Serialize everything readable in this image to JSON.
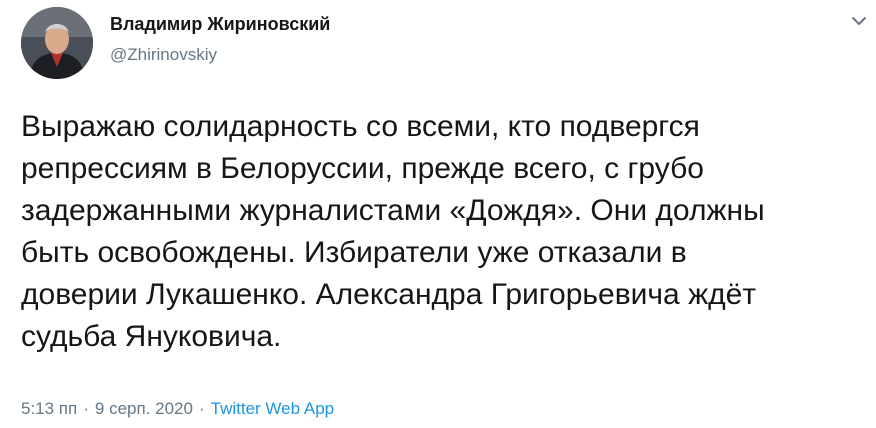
{
  "tweet": {
    "author_name": "Владимир Жириновский",
    "author_handle": "@Zhirinovskiy",
    "text": "Выражаю солидарность со всеми, кто подвергся\nрепрессиям в Белоруссии, прежде всего, с грубо\nзадержанными журналистами «Дождя». Они должны\nбыть освобождены. Избиратели уже отказали в\nдоверии Лукашенко. Александра Григорьевича ждёт\nсудьба Януковича.",
    "time": "5:13 пп",
    "separator": "·",
    "date": "9 серп. 2020",
    "separator2": "·",
    "source": "Twitter Web App"
  },
  "icons": {
    "avatar": "profile-photo",
    "menu": "chevron-down-icon"
  },
  "colors": {
    "text": "#14171a",
    "secondary": "#657786",
    "link": "#1b95e0"
  }
}
